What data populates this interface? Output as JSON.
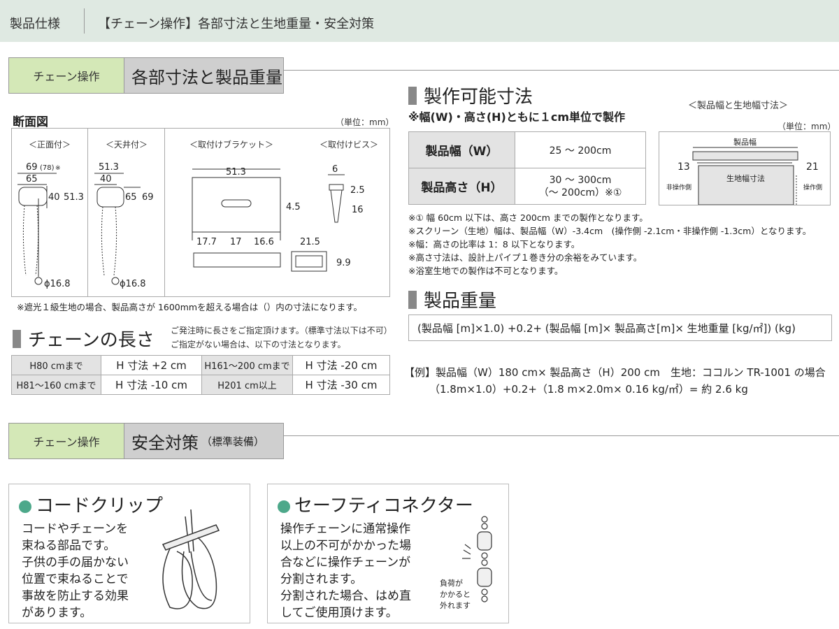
{
  "header": {
    "category": "製品仕様",
    "title": "【チェーン操作】各部寸法と生地重量・安全対策"
  },
  "section1": {
    "tag": "チェーン操作",
    "title": "各部寸法と製品重量"
  },
  "cross_section": {
    "title": "断面図",
    "unit": "（単位：mm）",
    "cols": [
      "＜正面付＞",
      "＜天井付＞",
      "＜取付けブラケット＞",
      "＜取付けビス＞"
    ],
    "front": {
      "d1": "69",
      "d1_paren": "(78)",
      "d1_mark": "※",
      "d2": "65",
      "d3": "40",
      "d4": "51.3",
      "dia": "ϕ16.8"
    },
    "ceiling": {
      "d1": "51.3",
      "d2": "40",
      "d3": "65",
      "d4": "69",
      "dia": "ϕ16.8"
    },
    "bracket": {
      "w": "51.3",
      "h": "4.5",
      "a": "17.7",
      "b": "17",
      "c": "16.6",
      "w2": "21.5",
      "h2": "9.9"
    },
    "screw": {
      "d": "6",
      "head": "2.5",
      "len": "16"
    },
    "note": "※遮光１級生地の場合、製品高さが 1600mmを超える場合は（）内の寸法になります。"
  },
  "chain_length": {
    "title": "チェーンの長さ",
    "desc1": "ご発注時に長さをご指定頂けます。（標準寸法以下は不可）",
    "desc2": "ご指定がない場合は、以下の寸法となります。",
    "rows": [
      [
        "H80 cmまで",
        "H 寸法 +2 cm",
        "H161～200 cmまで",
        "H 寸法 -20 cm"
      ],
      [
        "H81～160 cmまで",
        "H 寸法 -10 cm",
        "H201 cm以上",
        "H 寸法 -30 cm"
      ]
    ]
  },
  "size_range": {
    "title": "製作可能寸法",
    "subtitle": "※幅(W)・高さ(H)ともに１cm単位で製作",
    "rows": [
      {
        "label": "製品幅（W）",
        "value": "25 ～ 200cm",
        "value2": ""
      },
      {
        "label": "製品高さ（H）",
        "value": "30 ～ 300cm",
        "value2": "（～ 200cm）※①"
      }
    ],
    "diagram_title": "＜製品幅と生地幅寸法＞",
    "diagram_unit": "（単位：mm）",
    "diagram": {
      "top": "製品幅",
      "left_num": "13",
      "right_num": "21",
      "center": "生地幅寸法",
      "left_lbl": "非操作側",
      "right_lbl": "操作側"
    },
    "notes": [
      "※① 幅 60cm 以下は、高さ 200cm までの製作となります。",
      "※スクリーン（生地）幅は、製品幅（W）-3.4cm　(操作側 -2.1cm・非操作側 -1.3cm）となります。",
      "※幅：高さの比率は 1：8 以下となります。",
      "※高さ寸法は、設計上パイプ１巻き分の余裕をみています。",
      "※浴室生地での製作は不可となります。"
    ]
  },
  "weight": {
    "title": "製品重量",
    "formula": "(製品幅 [m]×1.0) +0.2+ (製品幅 [m]× 製品高さ[m]× 生地重量 [kg/㎡]) (kg)",
    "example1": "【例】製品幅（W）180 cm× 製品高さ（H）200 cm　生地：ココルン TR-1001 の場合",
    "example2": "（1.8m×1.0）+0.2+（1.8 m×2.0m× 0.16 kg/㎡）= 約 2.6 kg"
  },
  "section2": {
    "tag": "チェーン操作",
    "title": "安全対策",
    "title_note": "（標準装備）"
  },
  "cord_clip": {
    "title": "コードクリップ",
    "lines": [
      "コードやチェーンを",
      "束ねる部品です。",
      "子供の手の届かない",
      "位置で束ねることで",
      "事故を防止する効果",
      "があります。"
    ]
  },
  "safety_connector": {
    "title": "セーフティコネクター",
    "lines": [
      "操作チェーンに通常操作",
      "以上の不可がかかった場",
      "合などに操作チェーンが",
      "分割されます。",
      "分割された場合、はめ直",
      "してご使用頂けます。"
    ],
    "label": [
      "負荷が",
      "かかると",
      "外れます"
    ]
  },
  "colors": {
    "accent_green": "#d4e8b7",
    "header_bg": "#dfe9e2",
    "dot": "#4da88a"
  }
}
